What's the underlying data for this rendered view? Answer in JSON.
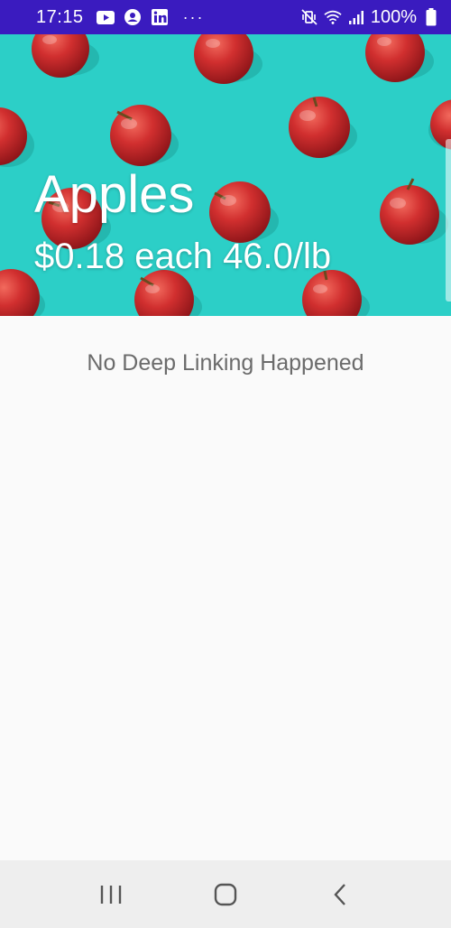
{
  "status_bar": {
    "time": "17:15",
    "battery": "100%",
    "overflow_indicator": "···",
    "left_icons": [
      "youtube-icon",
      "account-icon",
      "linkedin-icon"
    ],
    "right_icons": [
      "mute-vibrate-icon",
      "wifi-icon",
      "signal-icon",
      "battery-icon"
    ]
  },
  "hero": {
    "title": "Apples",
    "price_line": "$0.18 each 46.0/lb",
    "background_color": "#2ccfc7"
  },
  "content": {
    "message": "No Deep Linking Happened"
  },
  "nav_bar": {
    "buttons": [
      "recent-apps",
      "home",
      "back"
    ]
  },
  "colors": {
    "status_bar": "#3a1bbf",
    "apple_red": "#c8282c",
    "text_gray": "#6b6b6b"
  }
}
